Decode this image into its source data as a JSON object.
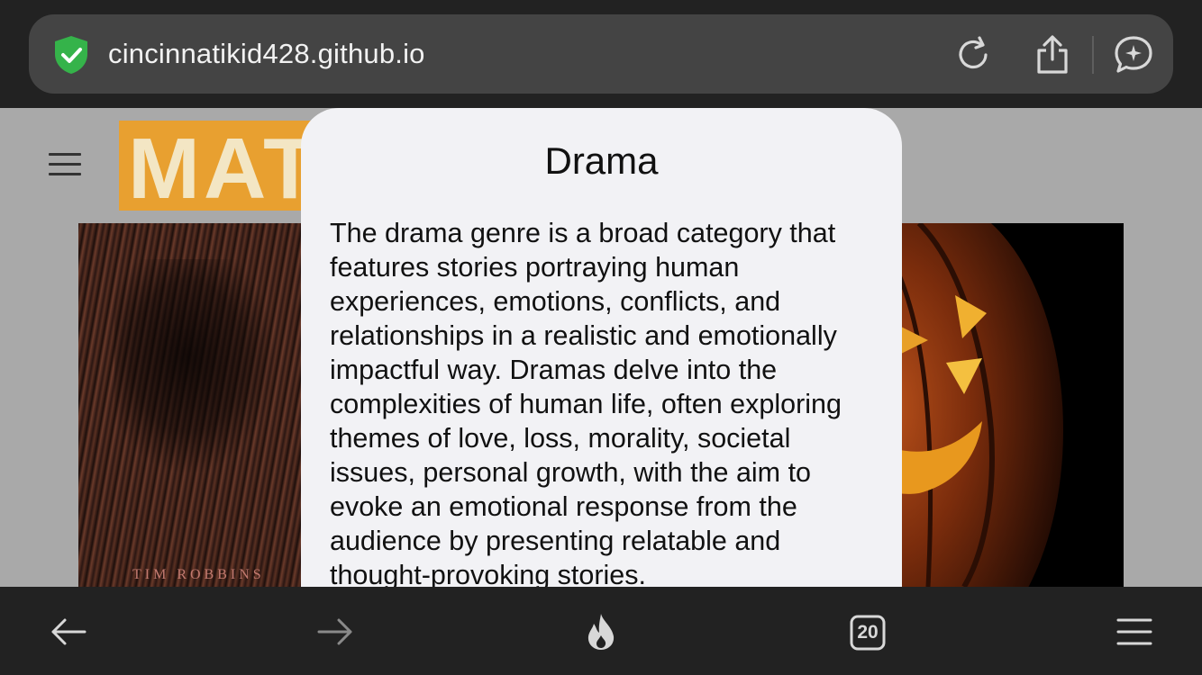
{
  "browser": {
    "url": "cincinnatikid428.github.io",
    "icons": [
      "shield-check-icon",
      "reload-icon",
      "share-icon",
      "assistant-icon"
    ]
  },
  "page": {
    "logo_text": "MAT",
    "poster_credit": "TIM ROBBINS"
  },
  "modal": {
    "title": "Drama",
    "body": "The drama genre is a broad category that features stories portraying human experiences, emotions, conflicts, and relationships in a realistic and emotionally impactful way. Dramas delve into the complexities of human life, often exploring themes of love, loss, morality, societal issues, personal growth, with the aim to evoke an emotional response from the audience by presenting relatable and thought-provoking stories."
  },
  "toolbar": {
    "tab_count": "20",
    "icons": [
      "back-arrow-icon",
      "forward-arrow-icon",
      "fire-icon",
      "tabs-icon",
      "menu-icon"
    ]
  },
  "colors": {
    "chrome": "#222222",
    "urlbar": "#444444",
    "shield": "#35b34a",
    "modal": "#f2f2f5",
    "logo": "#e8a030"
  }
}
